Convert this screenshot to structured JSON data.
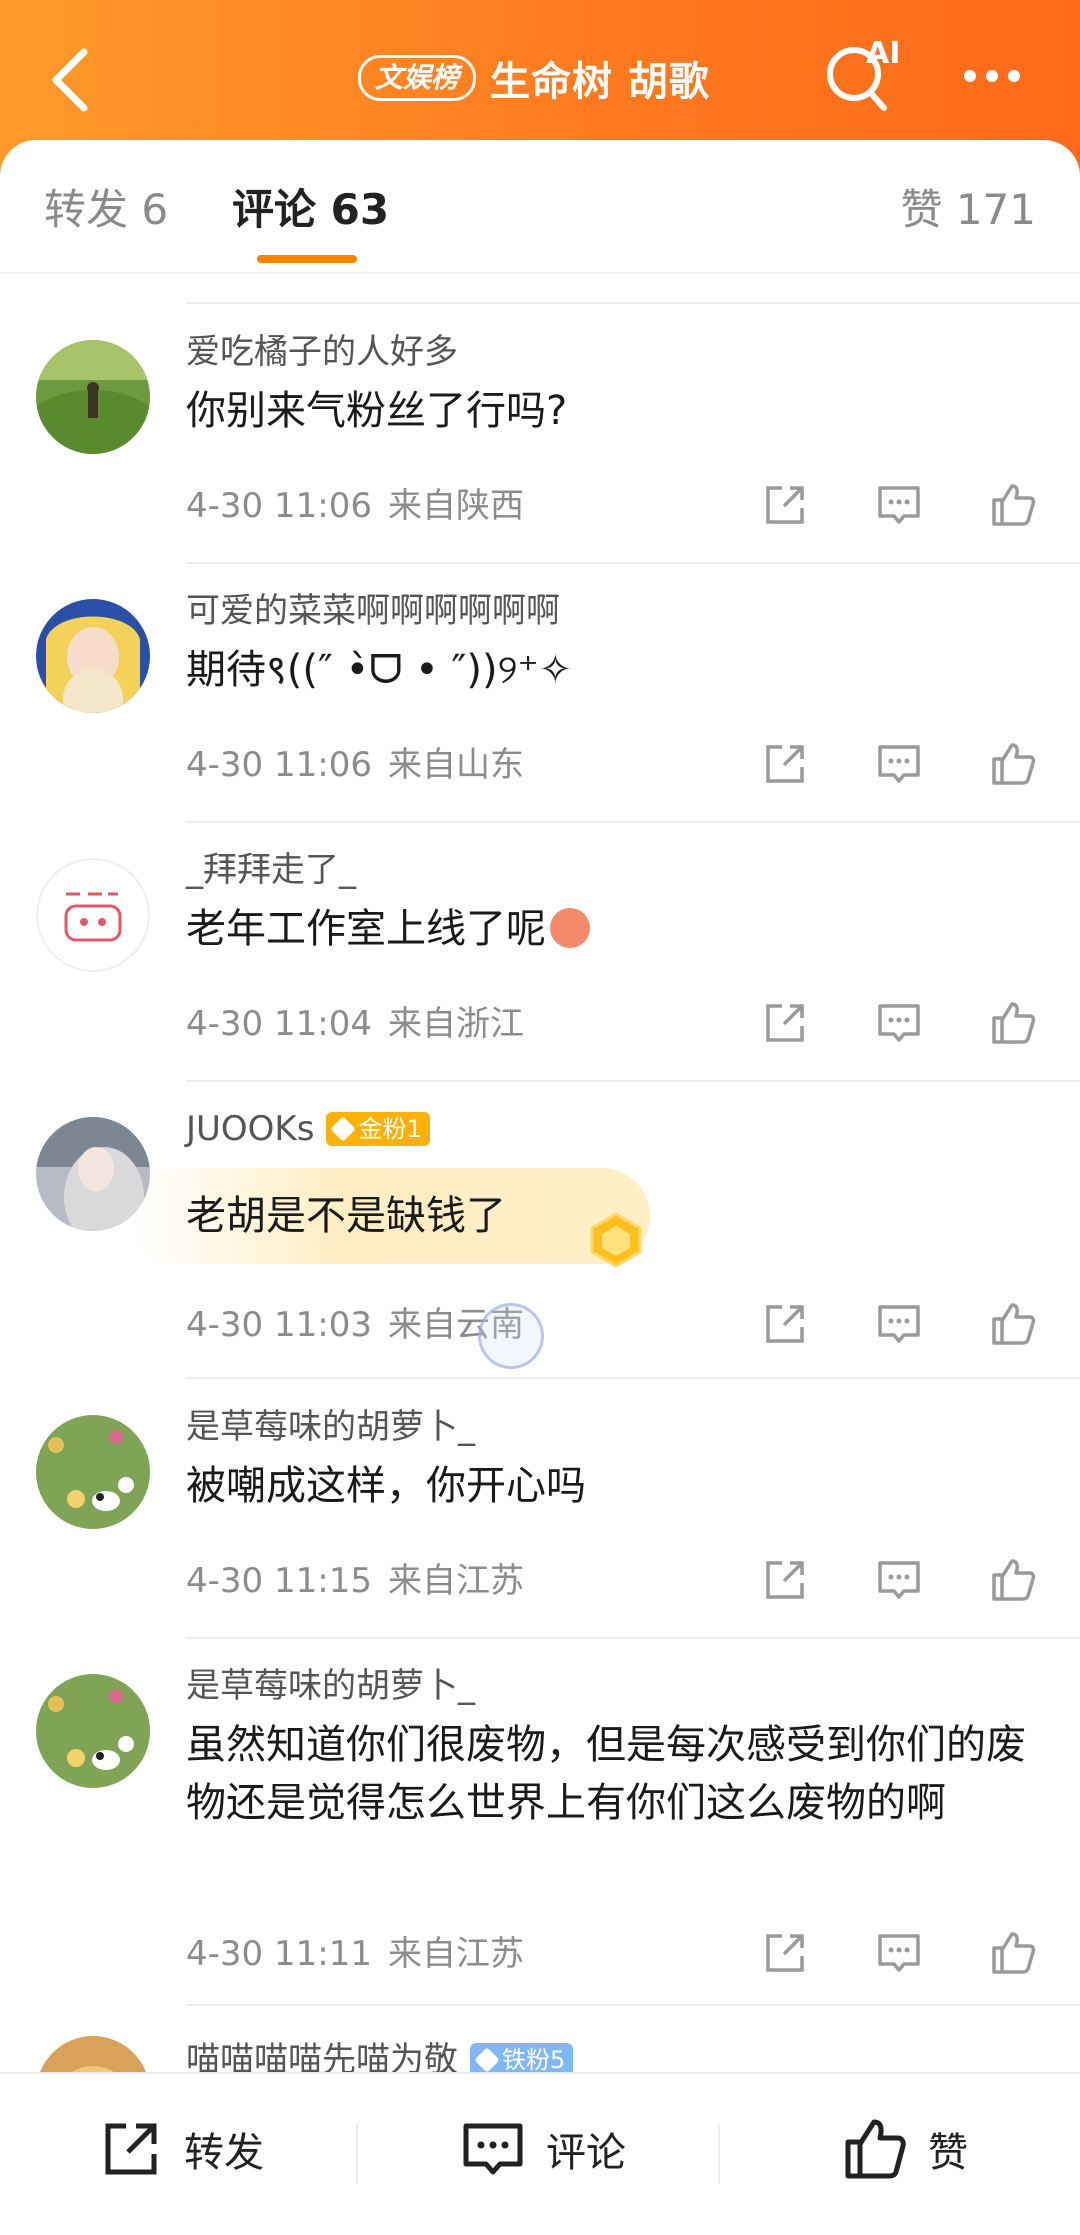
{
  "header": {
    "badge": "文娱榜",
    "title": "生命树 胡歌",
    "ai_label": "AI"
  },
  "tabs": {
    "repost": "转发 6",
    "comment": "评论 63",
    "like": "赞 171"
  },
  "comments": [
    {
      "name": "爱吃橘子的人好多",
      "text": "你别来气粉丝了行吗?",
      "time": "4-30 11:06",
      "location": "来自陕西"
    },
    {
      "name": "可爱的菜菜啊啊啊啊啊啊",
      "text": "期待९((″ •̀ᗜ • ″))୨⁺✧",
      "time": "4-30 11:06",
      "location": "来自山东"
    },
    {
      "name": "_拜拜走了_",
      "text": "老年工作室上线了呢",
      "time": "4-30 11:04",
      "location": "来自浙江"
    },
    {
      "name": "JUOOKs",
      "badge": "金粉1",
      "text": "老胡是不是缺钱了",
      "time": "4-30 11:03",
      "location": "来自云南"
    },
    {
      "name": "是草莓味的胡萝卜_",
      "text": "被嘲成这样，你开心吗",
      "time": "4-30 11:15",
      "location": "来自江苏"
    },
    {
      "name": "是草莓味的胡萝卜_",
      "text": "虽然知道你们很废物，但是每次感受到你们的废物还是觉得怎么世界上有你们这么废物的啊",
      "time": "4-30 11:11",
      "location": "来自江苏"
    },
    {
      "name": "喵喵喵喵先喵为敬",
      "badge": "铁粉5"
    }
  ],
  "bottom_bar": {
    "repost": "转发",
    "comment": "评论",
    "like": "赞"
  },
  "colors": {
    "header_start": "#ff9a2a",
    "header_end": "#ff6a1a",
    "accent": "#ff8200"
  }
}
